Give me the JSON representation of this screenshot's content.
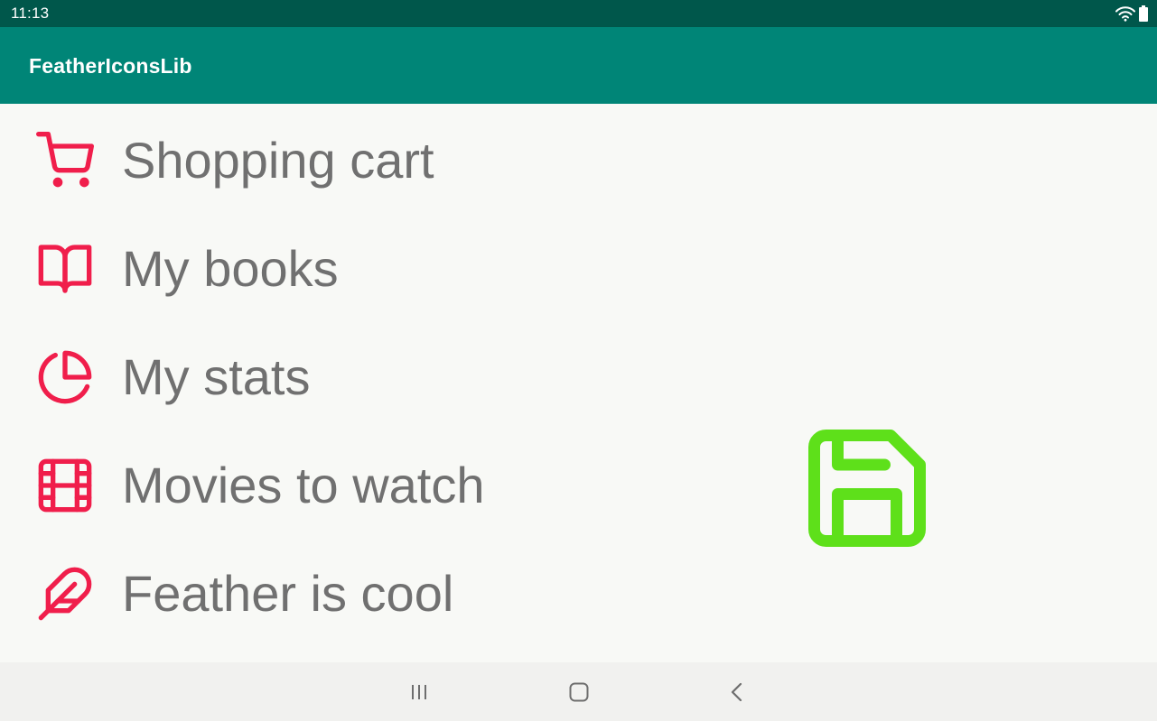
{
  "status_bar": {
    "time": "11:13",
    "icons": [
      "wifi-icon",
      "battery-icon"
    ]
  },
  "app_bar": {
    "title": "FeatherIconsLib",
    "background": "#008577"
  },
  "list": {
    "icon_color": "#f01e4b",
    "items": [
      {
        "icon": "shopping-cart-icon",
        "label": "Shopping cart"
      },
      {
        "icon": "book-open-icon",
        "label": "My books"
      },
      {
        "icon": "pie-chart-icon",
        "label": "My stats"
      },
      {
        "icon": "film-icon",
        "label": "Movies to watch"
      },
      {
        "icon": "feather-icon",
        "label": "Feather is cool"
      }
    ]
  },
  "highlight_icon": {
    "icon": "save-icon",
    "color": "#5ee01a"
  },
  "nav_bar": {
    "buttons": [
      "recent-apps-icon",
      "home-icon",
      "back-icon"
    ]
  }
}
